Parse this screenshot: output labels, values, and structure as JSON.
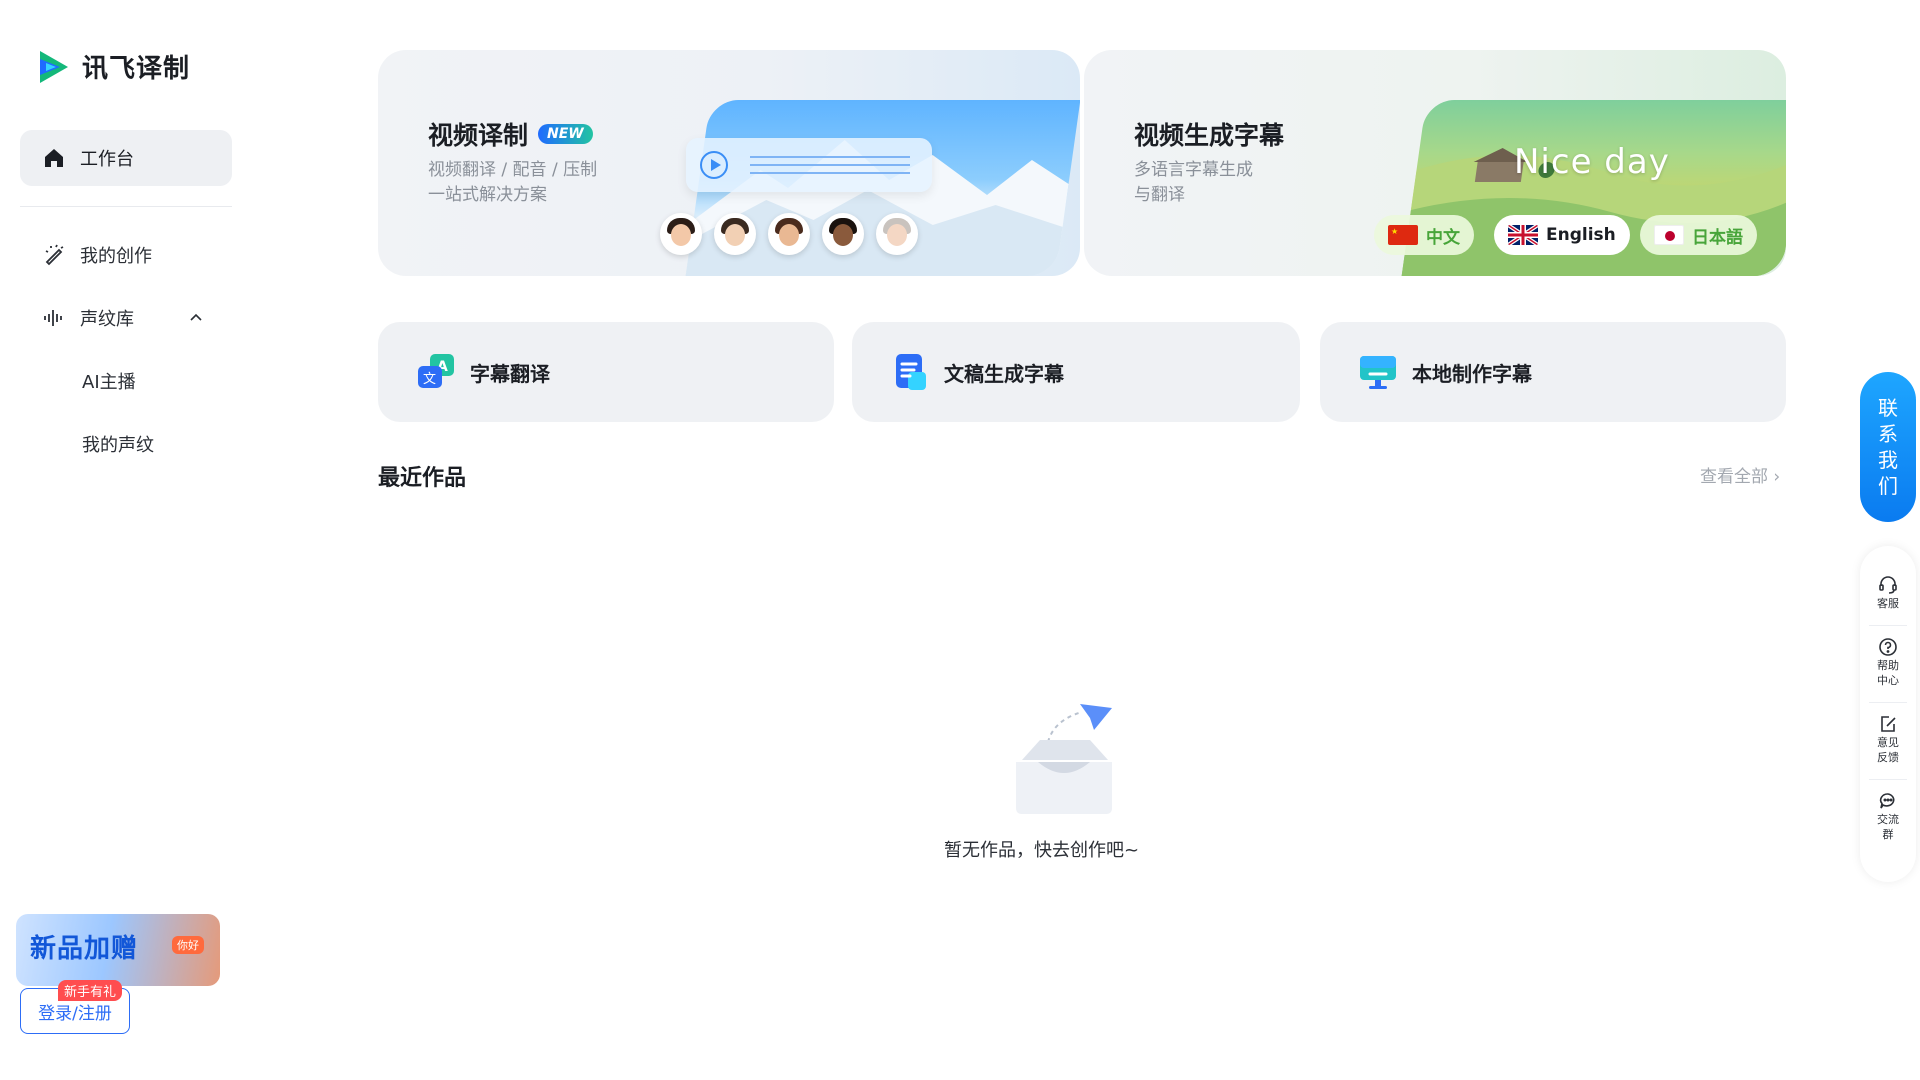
{
  "brand": {
    "name": "讯飞译制"
  },
  "sidebar": {
    "workspace_label": "工作台",
    "items": [
      {
        "label": "我的创作"
      },
      {
        "label": "声纹库"
      }
    ],
    "sub_items": [
      {
        "label": "AI主播"
      },
      {
        "label": "我的声纹"
      }
    ],
    "promo": {
      "title": "新品加赠",
      "tag": "你好"
    },
    "newbie_badge": "新手有礼",
    "login_label": "登录/注册"
  },
  "banners": [
    {
      "title": "视频译制",
      "badge": "NEW",
      "desc": "视频翻译 / 配音 / 压制一站式解决方案"
    },
    {
      "title": "视频生成字幕",
      "desc": "多语言字幕生成与翻译",
      "overlay_text": "Nice day",
      "languages": [
        {
          "label": "中文"
        },
        {
          "label": "English"
        },
        {
          "label": "日本語"
        }
      ]
    }
  ],
  "tools": [
    {
      "label": "字幕翻译"
    },
    {
      "label": "文稿生成字幕"
    },
    {
      "label": "本地制作字幕"
    }
  ],
  "recent": {
    "title": "最近作品",
    "view_all": "查看全部",
    "empty_text": "暂无作品，快去创作吧~"
  },
  "float": {
    "contact": "联系我们",
    "contact_chars": [
      "联",
      "系",
      "我",
      "们"
    ],
    "items": [
      {
        "label": "客服",
        "icon": "headset-icon"
      },
      {
        "label": "帮助中心",
        "icon": "help-icon"
      },
      {
        "label": "意见反馈",
        "icon": "feedback-icon"
      },
      {
        "label": "交流群",
        "icon": "chat-icon"
      }
    ]
  },
  "colors": {
    "primary": "#2d6df6",
    "accent_green": "#48a53a",
    "contact_blue": "#0a7bf0"
  }
}
